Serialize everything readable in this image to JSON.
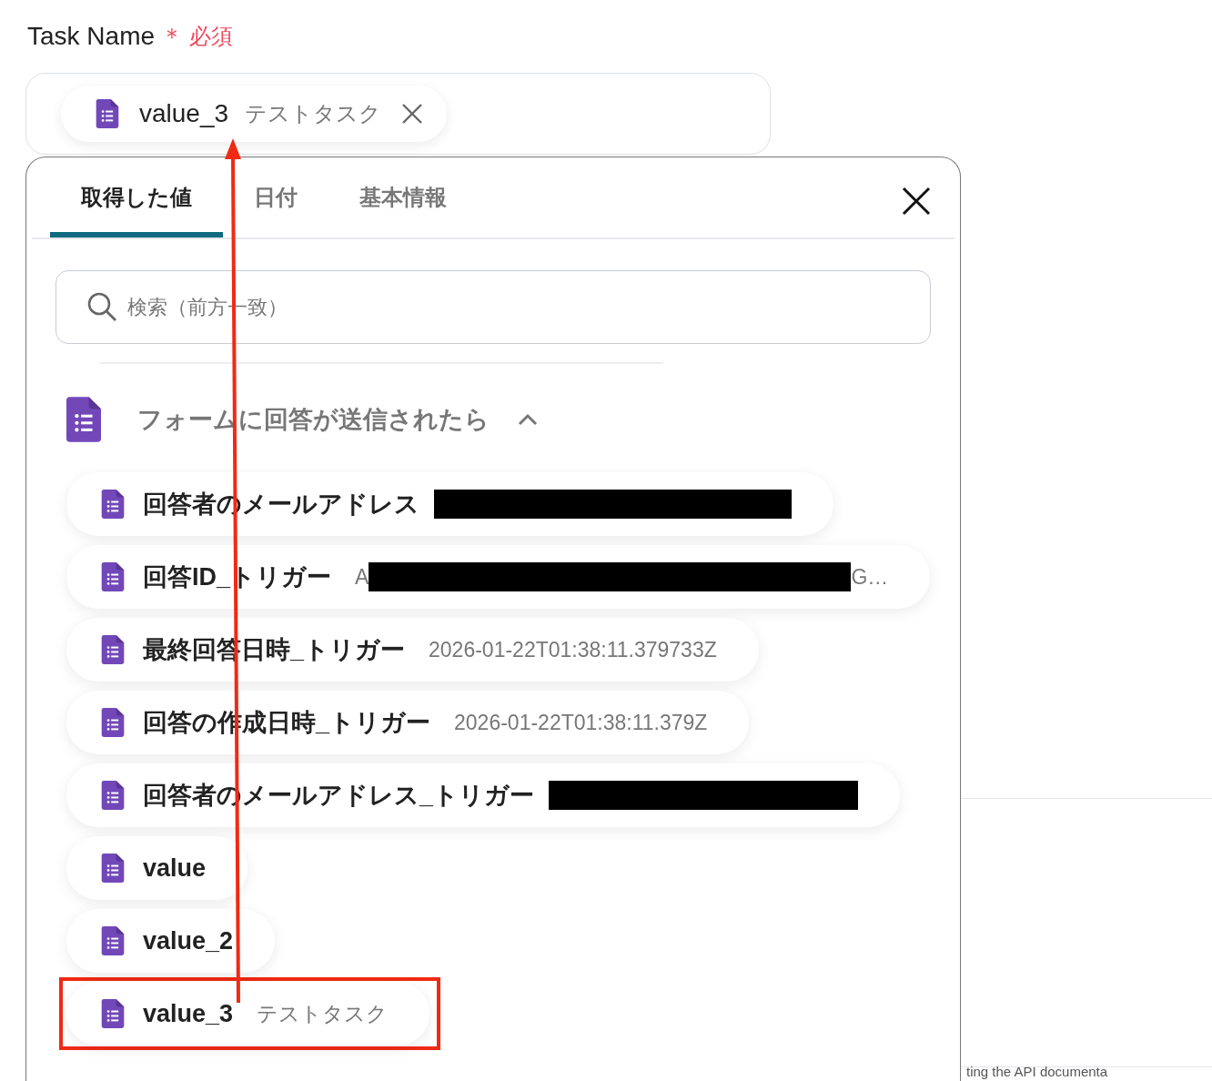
{
  "field": {
    "label": "Task Name",
    "required_mark": "＊",
    "required_text": "必須",
    "chip": {
      "name": "value_3",
      "value": "テストタスク"
    }
  },
  "panel": {
    "tabs": [
      {
        "label": "取得した値",
        "selected": true
      },
      {
        "label": "日付",
        "selected": false
      },
      {
        "label": "基本情報",
        "selected": false
      }
    ],
    "search": {
      "placeholder": "検索（前方一致）"
    },
    "group": {
      "title": "フォームに回答が送信されたら",
      "expanded": true
    },
    "items": [
      {
        "label": "回答者のメールアドレス",
        "redacted": true,
        "highlighted": false
      },
      {
        "label": "回答ID_トリガー",
        "value": "A",
        "redacted": true,
        "value_end": "G…",
        "highlighted": false
      },
      {
        "label": "最終回答日時_トリガー",
        "value": "2026-01-22T01:38:11.379733Z",
        "redacted": false,
        "highlighted": false
      },
      {
        "label": "回答の作成日時_トリガー",
        "value": "2026-01-22T01:38:11.379Z",
        "redacted": false,
        "highlighted": false
      },
      {
        "label": "回答者のメールアドレス_トリガー",
        "redacted": true,
        "highlighted": false
      },
      {
        "label": "value",
        "redacted": false,
        "highlighted": false
      },
      {
        "label": "value_2",
        "redacted": false,
        "highlighted": false
      },
      {
        "label": "value_3",
        "value": "テストタスク",
        "redacted": false,
        "highlighted": true
      }
    ]
  },
  "background_text": "ting the API documenta"
}
